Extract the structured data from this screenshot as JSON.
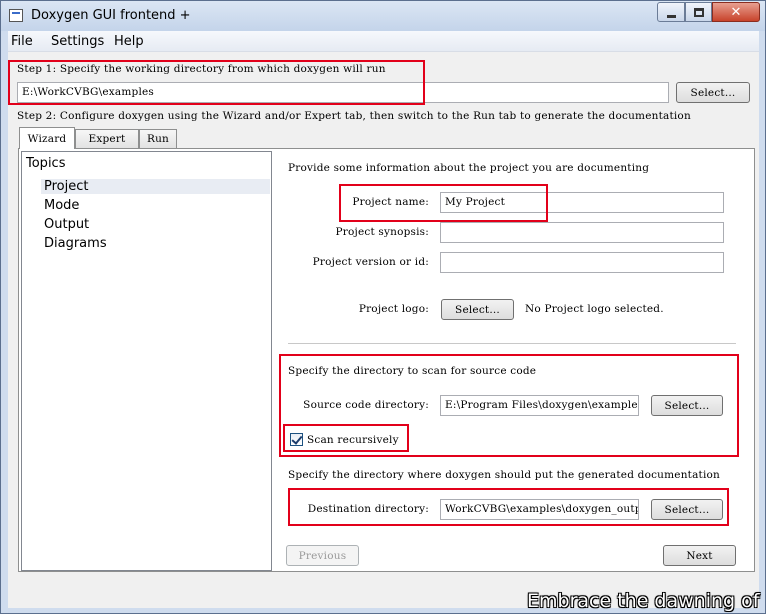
{
  "window": {
    "title": "Doxygen GUI frontend +"
  },
  "menu": [
    "File",
    "Settings",
    "Help"
  ],
  "step1": {
    "label": "Step 1: Specify the working directory from which doxygen will run",
    "path": "E:\\WorkCVBG\\examples",
    "select_label": "Select..."
  },
  "step2": {
    "label": "Step 2: Configure doxygen using the Wizard and/or Expert tab, then switch to the Run tab to generate the documentation"
  },
  "tabs": [
    "Wizard",
    "Expert",
    "Run"
  ],
  "topics": {
    "header": "Topics",
    "items": [
      "Project",
      "Mode",
      "Output",
      "Diagrams"
    ],
    "selected": "Project"
  },
  "project": {
    "intro": "Provide some information about the project you are documenting",
    "name_label": "Project name:",
    "name_value": "My Project",
    "synopsis_label": "Project synopsis:",
    "synopsis_value": "",
    "version_label": "Project version or id:",
    "version_value": "",
    "logo_label": "Project logo:",
    "logo_button": "Select...",
    "logo_status": "No Project logo selected."
  },
  "source": {
    "heading": "Specify the directory to scan for source code",
    "label": "Source code directory:",
    "value": "E:\\Program Files\\doxygen\\examples",
    "select_label": "Select...",
    "recursive_label": "Scan recursively",
    "recursive_checked": true
  },
  "destination": {
    "heading": "Specify the directory where doxygen should put the generated documentation",
    "label": "Destination directory:",
    "value": "WorkCVBG\\examples\\doxygen_output",
    "select_label": "Select..."
  },
  "nav": {
    "previous": "Previous",
    "next": "Next"
  },
  "watermark": "Embrace the dawning of"
}
